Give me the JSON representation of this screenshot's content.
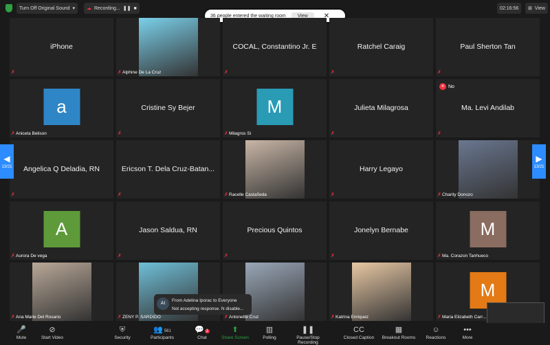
{
  "topbar": {
    "sound_label": "Turn Off Original Sound",
    "recording_label": "Recording...",
    "time": "02:16:56",
    "view_label": "View"
  },
  "toast": {
    "text": "36 people entered the waiting room",
    "view_label": "View"
  },
  "page": "13/21",
  "tiles": [
    {
      "name": "iPhone",
      "label": "",
      "kind": "name"
    },
    {
      "name": "",
      "label": "Alphine De La Cruz",
      "kind": "photo",
      "color": "#7ad0ea"
    },
    {
      "name": "COCAL, Constantino Jr. E",
      "label": "",
      "kind": "name"
    },
    {
      "name": "Ratchel Caraig",
      "label": "",
      "kind": "name"
    },
    {
      "name": "Paul Sherton Tan",
      "label": "",
      "kind": "name"
    },
    {
      "name": "",
      "label": "Aniceta Belison",
      "kind": "avatar",
      "letter": "a",
      "color": "#2f86c6"
    },
    {
      "name": "Cristine Sy Bejer",
      "label": "",
      "kind": "name"
    },
    {
      "name": "",
      "label": "Milagros Si",
      "kind": "avatar",
      "letter": "M",
      "color": "#2a9bb5"
    },
    {
      "name": "Julieta Milagrosa",
      "label": "",
      "kind": "name"
    },
    {
      "name": "Ma. Levi Andilab",
      "label": "",
      "kind": "name",
      "badge": "No"
    },
    {
      "name": "Angelica Q Deladia, RN",
      "label": "",
      "kind": "name"
    },
    {
      "name": "Ericson T. Dela Cruz-Batan...",
      "label": "",
      "kind": "name"
    },
    {
      "name": "",
      "label": "Racelle Castañeda",
      "kind": "photo",
      "color": "#c9b6a6"
    },
    {
      "name": "Harry Legayo",
      "label": "",
      "kind": "name"
    },
    {
      "name": "",
      "label": "Charity Donozo",
      "kind": "photo",
      "color": "#6a7790"
    },
    {
      "name": "",
      "label": "Aurora De vega",
      "kind": "avatar",
      "letter": "A",
      "color": "#5e9a3a"
    },
    {
      "name": "Jason Saldua, RN",
      "label": "",
      "kind": "name"
    },
    {
      "name": "Precious Quintos",
      "label": "",
      "kind": "name"
    },
    {
      "name": "Jonelyn Bernabe",
      "label": "",
      "kind": "name"
    },
    {
      "name": "",
      "label": "Ma. Corazon Tanhueco",
      "kind": "avatar",
      "letter": "M",
      "color": "#8a6c60"
    },
    {
      "name": "",
      "label": "Ana Marie Del Rosario",
      "kind": "photo",
      "color": "#b9a898"
    },
    {
      "name": "",
      "label": "ZENY P. SARDIDO",
      "kind": "photo",
      "color": "#6fbfd8"
    },
    {
      "name": "",
      "label": "Antonette Cruz",
      "kind": "photo",
      "color": "#9aa7b8"
    },
    {
      "name": "",
      "label": "Katrina Enriquez",
      "kind": "photo",
      "color": "#e8c8a4"
    },
    {
      "name": "",
      "label": "Maria Elizabeth Carr...",
      "kind": "avatar",
      "letter": "M",
      "color": "#e47a15"
    }
  ],
  "chat": {
    "avatar": "AI",
    "from": "From Adelina Iporac to Everyone",
    "message": "Not accepting response. N disable..."
  },
  "toolbar": [
    {
      "label": "Mute",
      "icon": "microphone-icon"
    },
    {
      "label": "Start Video",
      "icon": "video-off-icon"
    },
    {
      "label": "Security",
      "icon": "shield-icon"
    },
    {
      "label": "Participants",
      "icon": "participants-icon",
      "count": "561"
    },
    {
      "label": "Chat",
      "icon": "chat-icon",
      "badge": "1"
    },
    {
      "label": "Share Screen",
      "icon": "share-icon"
    },
    {
      "label": "Polling",
      "icon": "polling-icon"
    },
    {
      "label": "Pause/Stop Recording",
      "icon": "recording-icon"
    },
    {
      "label": "Closed Caption",
      "icon": "cc-icon"
    },
    {
      "label": "Breakout Rooms",
      "icon": "breakout-icon"
    },
    {
      "label": "Reactions",
      "icon": "reactions-icon"
    },
    {
      "label": "More",
      "icon": "more-icon"
    }
  ],
  "colors": {
    "accent": "#2d8cff",
    "share": "#2ea043",
    "mute": "#e3372e"
  }
}
